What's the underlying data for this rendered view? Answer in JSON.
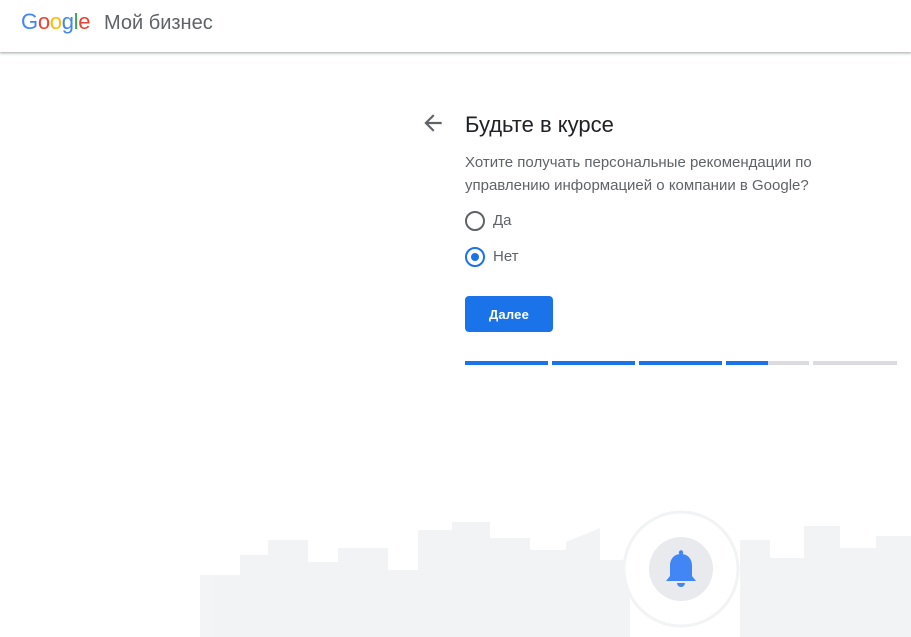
{
  "header": {
    "logo_letters": [
      "G",
      "o",
      "o",
      "g",
      "l",
      "e"
    ],
    "logo_colors": [
      "#4285F4",
      "#EA4335",
      "#FBBC05",
      "#4285F4",
      "#34A853",
      "#EA4335"
    ],
    "product_name": "Мой бизнес"
  },
  "main": {
    "back_icon": "arrow-back-icon",
    "title": "Будьте в курсе",
    "description": "Хотите получать персональные рекомендации по управлению информацией о компании в Google?",
    "options": [
      {
        "label": "Да",
        "selected": false
      },
      {
        "label": "Нет",
        "selected": true
      }
    ],
    "next_label": "Далее"
  },
  "progress": {
    "steps_total": 5,
    "step_fill": [
      1,
      1,
      1,
      0.5,
      0
    ],
    "accent_color": "#1a73e8",
    "track_color": "#dadce0"
  },
  "illustration": {
    "icon": "bell-icon",
    "bell_color": "#4285F4"
  }
}
